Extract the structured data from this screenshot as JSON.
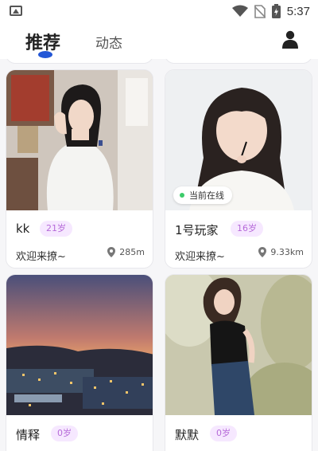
{
  "status_bar": {
    "time": "5:37",
    "icons": [
      "image-icon",
      "wifi-icon",
      "no-sim-icon",
      "battery-charging-icon"
    ]
  },
  "header": {
    "tabs": [
      {
        "label": "推荐",
        "active": true
      },
      {
        "label": "动态",
        "active": false
      }
    ],
    "profile_icon": "person-icon",
    "accent_color": "#2357d6"
  },
  "cards": [
    {
      "name": "kk",
      "age": "21岁",
      "greeting": "欢迎来撩~",
      "distance": "285m",
      "online": ""
    },
    {
      "name": "1号玩家",
      "age": "16岁",
      "greeting": "欢迎来撩~",
      "distance": "9.33km",
      "online": "当前在线"
    },
    {
      "name": "情释",
      "age": "0岁",
      "greeting": "",
      "distance": "",
      "online": ""
    },
    {
      "name": "默默",
      "age": "0岁",
      "greeting": "",
      "distance": "",
      "online": ""
    }
  ],
  "colors": {
    "age_badge_bg": "#f6e8ff",
    "age_badge_text": "#b66ad9",
    "online_dot": "#3ccb6a"
  }
}
